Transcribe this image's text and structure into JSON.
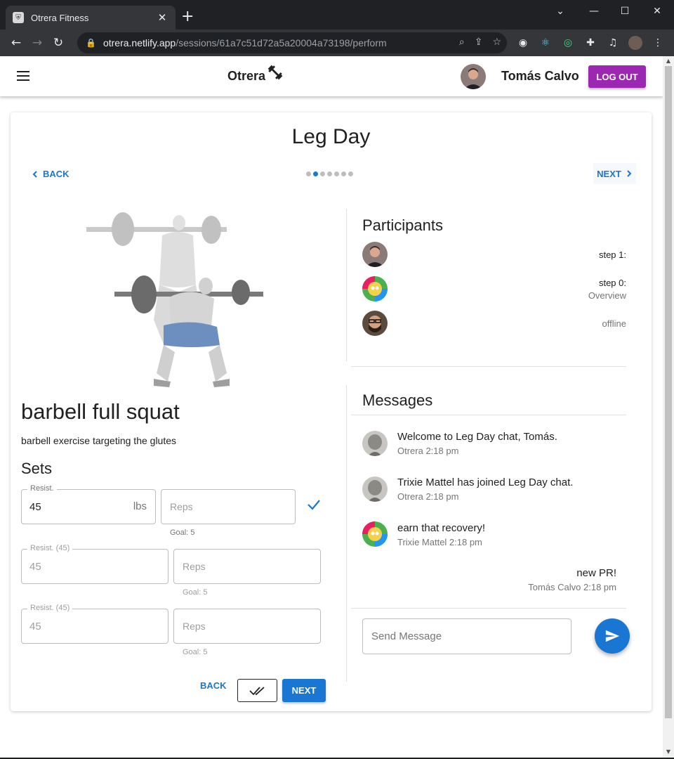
{
  "browser": {
    "tab_title": "Otrera Fitness",
    "url_host": "otrera.netlify.app",
    "url_path": "/sessions/61a7c51d72a5a20004a73198/perform"
  },
  "appbar": {
    "brand": "Otrera",
    "user_name": "Tomás Calvo",
    "logout_label": "LOG OUT"
  },
  "workout": {
    "title": "Leg Day",
    "back_label": "BACK",
    "next_label": "NEXT",
    "step_count": 7,
    "active_step": 1
  },
  "exercise": {
    "name": "barbell full squat",
    "description": "barbell exercise targeting the glutes",
    "sets_title": "Sets",
    "sets": [
      {
        "label": "Resist.",
        "value": "45",
        "unit": "lbs",
        "reps_placeholder": "Reps",
        "goal": "Goal: 5"
      },
      {
        "label": "Resist. (45)",
        "value": "45",
        "reps_placeholder": "Reps",
        "goal": "Goal: 5"
      },
      {
        "label": "Resist. (45)",
        "value": "45",
        "reps_placeholder": "Reps",
        "goal": "Goal: 5"
      }
    ],
    "back_label": "BACK",
    "next_label": "NEXT"
  },
  "participants": {
    "title": "Participants",
    "items": [
      {
        "status": "step 1:",
        "sub": ""
      },
      {
        "status": "step 0:",
        "sub": "Overview"
      },
      {
        "status": "offline",
        "sub": ""
      }
    ]
  },
  "messages": {
    "title": "Messages",
    "items": [
      {
        "text": "Welcome to Leg Day chat, Tomás.",
        "meta": "Otrera 2:18 pm"
      },
      {
        "text": "Trixie Mattel has joined Leg Day chat.",
        "meta": "Otrera 2:18 pm"
      },
      {
        "text": "earn that recovery!",
        "meta": "Trixie Mattel 2:18 pm"
      },
      {
        "text": "new PR!",
        "meta": "Tomás Calvo 2:18 pm"
      }
    ],
    "input_placeholder": "Send Message"
  },
  "colors": {
    "primary": "#1976d2",
    "logout": "#9c27b0"
  }
}
